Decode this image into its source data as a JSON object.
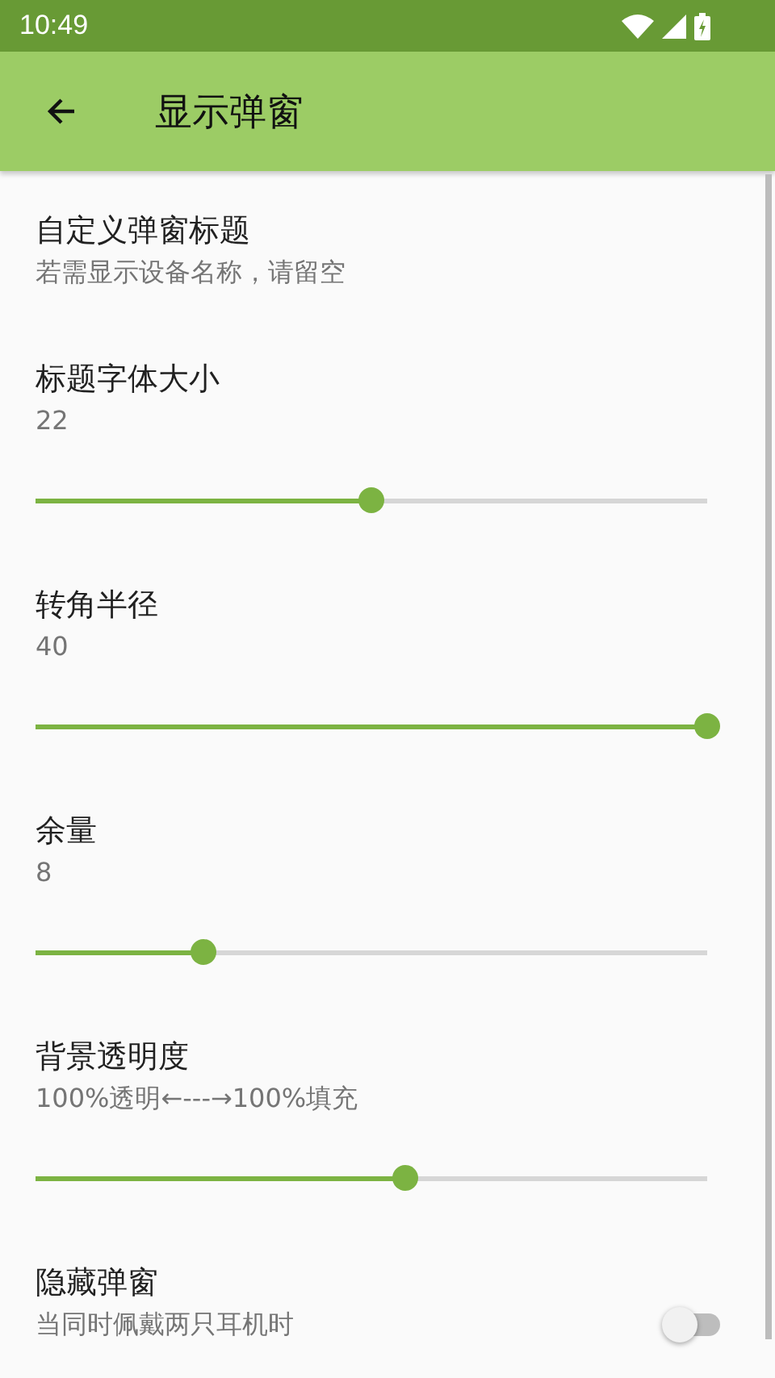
{
  "status_bar": {
    "time": "10:49"
  },
  "app_bar": {
    "title": "显示弹窗"
  },
  "settings": [
    {
      "kind": "text",
      "title": "自定义弹窗标题",
      "summary": "若需显示设备名称，请留空"
    },
    {
      "kind": "slider",
      "title": "标题字体大小",
      "summary": "22",
      "level": 0.5
    },
    {
      "kind": "slider",
      "title": "转角半径",
      "summary": "40",
      "level": 1
    },
    {
      "kind": "slider",
      "title": "余量",
      "summary": "8",
      "level": 0.25
    },
    {
      "kind": "slider",
      "title": "背景透明度",
      "summary": "100%透明←---→100%填充",
      "level": 0.55
    },
    {
      "kind": "switch",
      "title": "隐藏弹窗",
      "summary": "当同时佩戴两只耳机时",
      "on": false
    }
  ]
}
